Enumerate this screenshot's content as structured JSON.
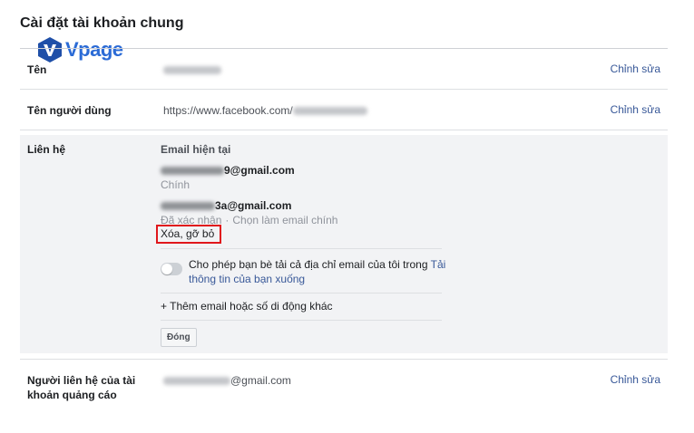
{
  "page": {
    "title": "Cài đặt tài khoản chung",
    "logo_text": "Vpage"
  },
  "rows": {
    "name": {
      "label": "Tên",
      "edit": "Chỉnh sửa"
    },
    "username": {
      "label": "Tên người dùng",
      "value_prefix": "https://www.facebook.com/",
      "edit": "Chỉnh sửa"
    },
    "contact": {
      "label": "Liên hệ",
      "heading": "Email hiện tại",
      "email1_suffix": "9@gmail.com",
      "email1_status": "Chính",
      "email2_suffix": "3a@gmail.com",
      "email2_status": "Đã xác nhận",
      "email2_make_primary": "Chọn làm email chính",
      "remove": "Xóa, gỡ bỏ",
      "toggle_text": "Cho phép bạn bè tải cả địa chỉ email của tôi trong ",
      "toggle_link": "Tải thông tin của bạn xuống",
      "add_email": "+ Thêm email hoặc số di động khác",
      "close": "Đóng"
    },
    "ad_contact": {
      "label": "Người liên hệ của tài khoản quảng cáo",
      "email_suffix": "@gmail.com",
      "edit": "Chỉnh sửa"
    }
  },
  "colors": {
    "link": "#385898",
    "highlight_box": "#e0171c",
    "logo": "#2b6bd6"
  }
}
